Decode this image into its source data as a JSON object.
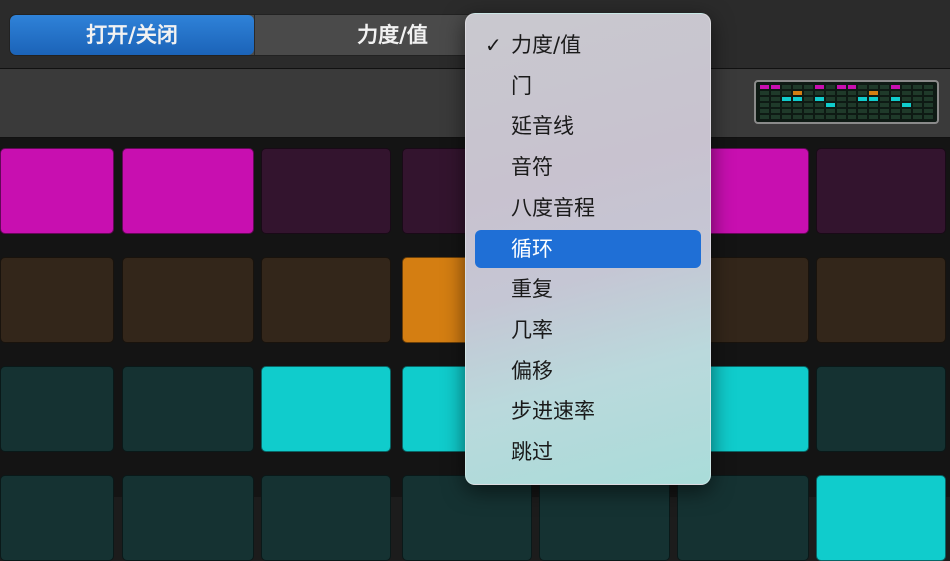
{
  "segmented": {
    "options": [
      {
        "label": "打开/关闭",
        "active": true
      },
      {
        "label": "力度/值",
        "active": false
      }
    ]
  },
  "menu": {
    "selected": "力度/值",
    "highlighted": "循环",
    "checkmark": "✓",
    "items": [
      "力度/值",
      "门",
      "延音线",
      "音符",
      "八度音程",
      "循环",
      "重复",
      "几率",
      "偏移",
      "步进速率",
      "跳过"
    ]
  },
  "grid": {
    "rows": [
      {
        "color_on": "#c80fb0",
        "color_off": "#33142e",
        "steps": [
          1,
          1,
          0,
          0,
          0,
          1,
          0
        ]
      },
      {
        "color_on": "#d47e12",
        "color_off": "#33261a",
        "steps": [
          0,
          0,
          0,
          1,
          0,
          0,
          0
        ]
      },
      {
        "color_on": "#10cccc",
        "color_off": "#153232",
        "steps": [
          0,
          0,
          1,
          1,
          0,
          1,
          0
        ]
      },
      {
        "color_on": "#10cccc",
        "color_off": "#153232",
        "steps": [
          0,
          0,
          0,
          0,
          0,
          0,
          1
        ]
      }
    ]
  }
}
